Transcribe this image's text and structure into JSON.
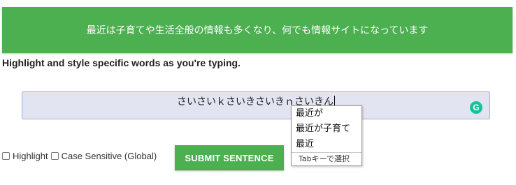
{
  "banner": {
    "text": "最近は子育てや生活全般の情報も多くなり、何でも情報サイトになっています"
  },
  "subtitle": "Highlight and style specific words as you're typing.",
  "input": {
    "value": "さいさいｋさいきさいきｎさいきん",
    "assistant_icon": "grammarly-icon"
  },
  "suggestions": {
    "items": [
      "最近が",
      "最近が子育て",
      "最近"
    ],
    "footer": "Tabキーで選択"
  },
  "options": {
    "highlight_label": "Highlight",
    "case_sensitive_label": "Case Sensitive (Global)"
  },
  "submit_label": "SUBMIT SENTENCE",
  "colors": {
    "accent": "#4caf50",
    "input_bg": "#e3e4f1",
    "grammarly": "#15c39a"
  }
}
